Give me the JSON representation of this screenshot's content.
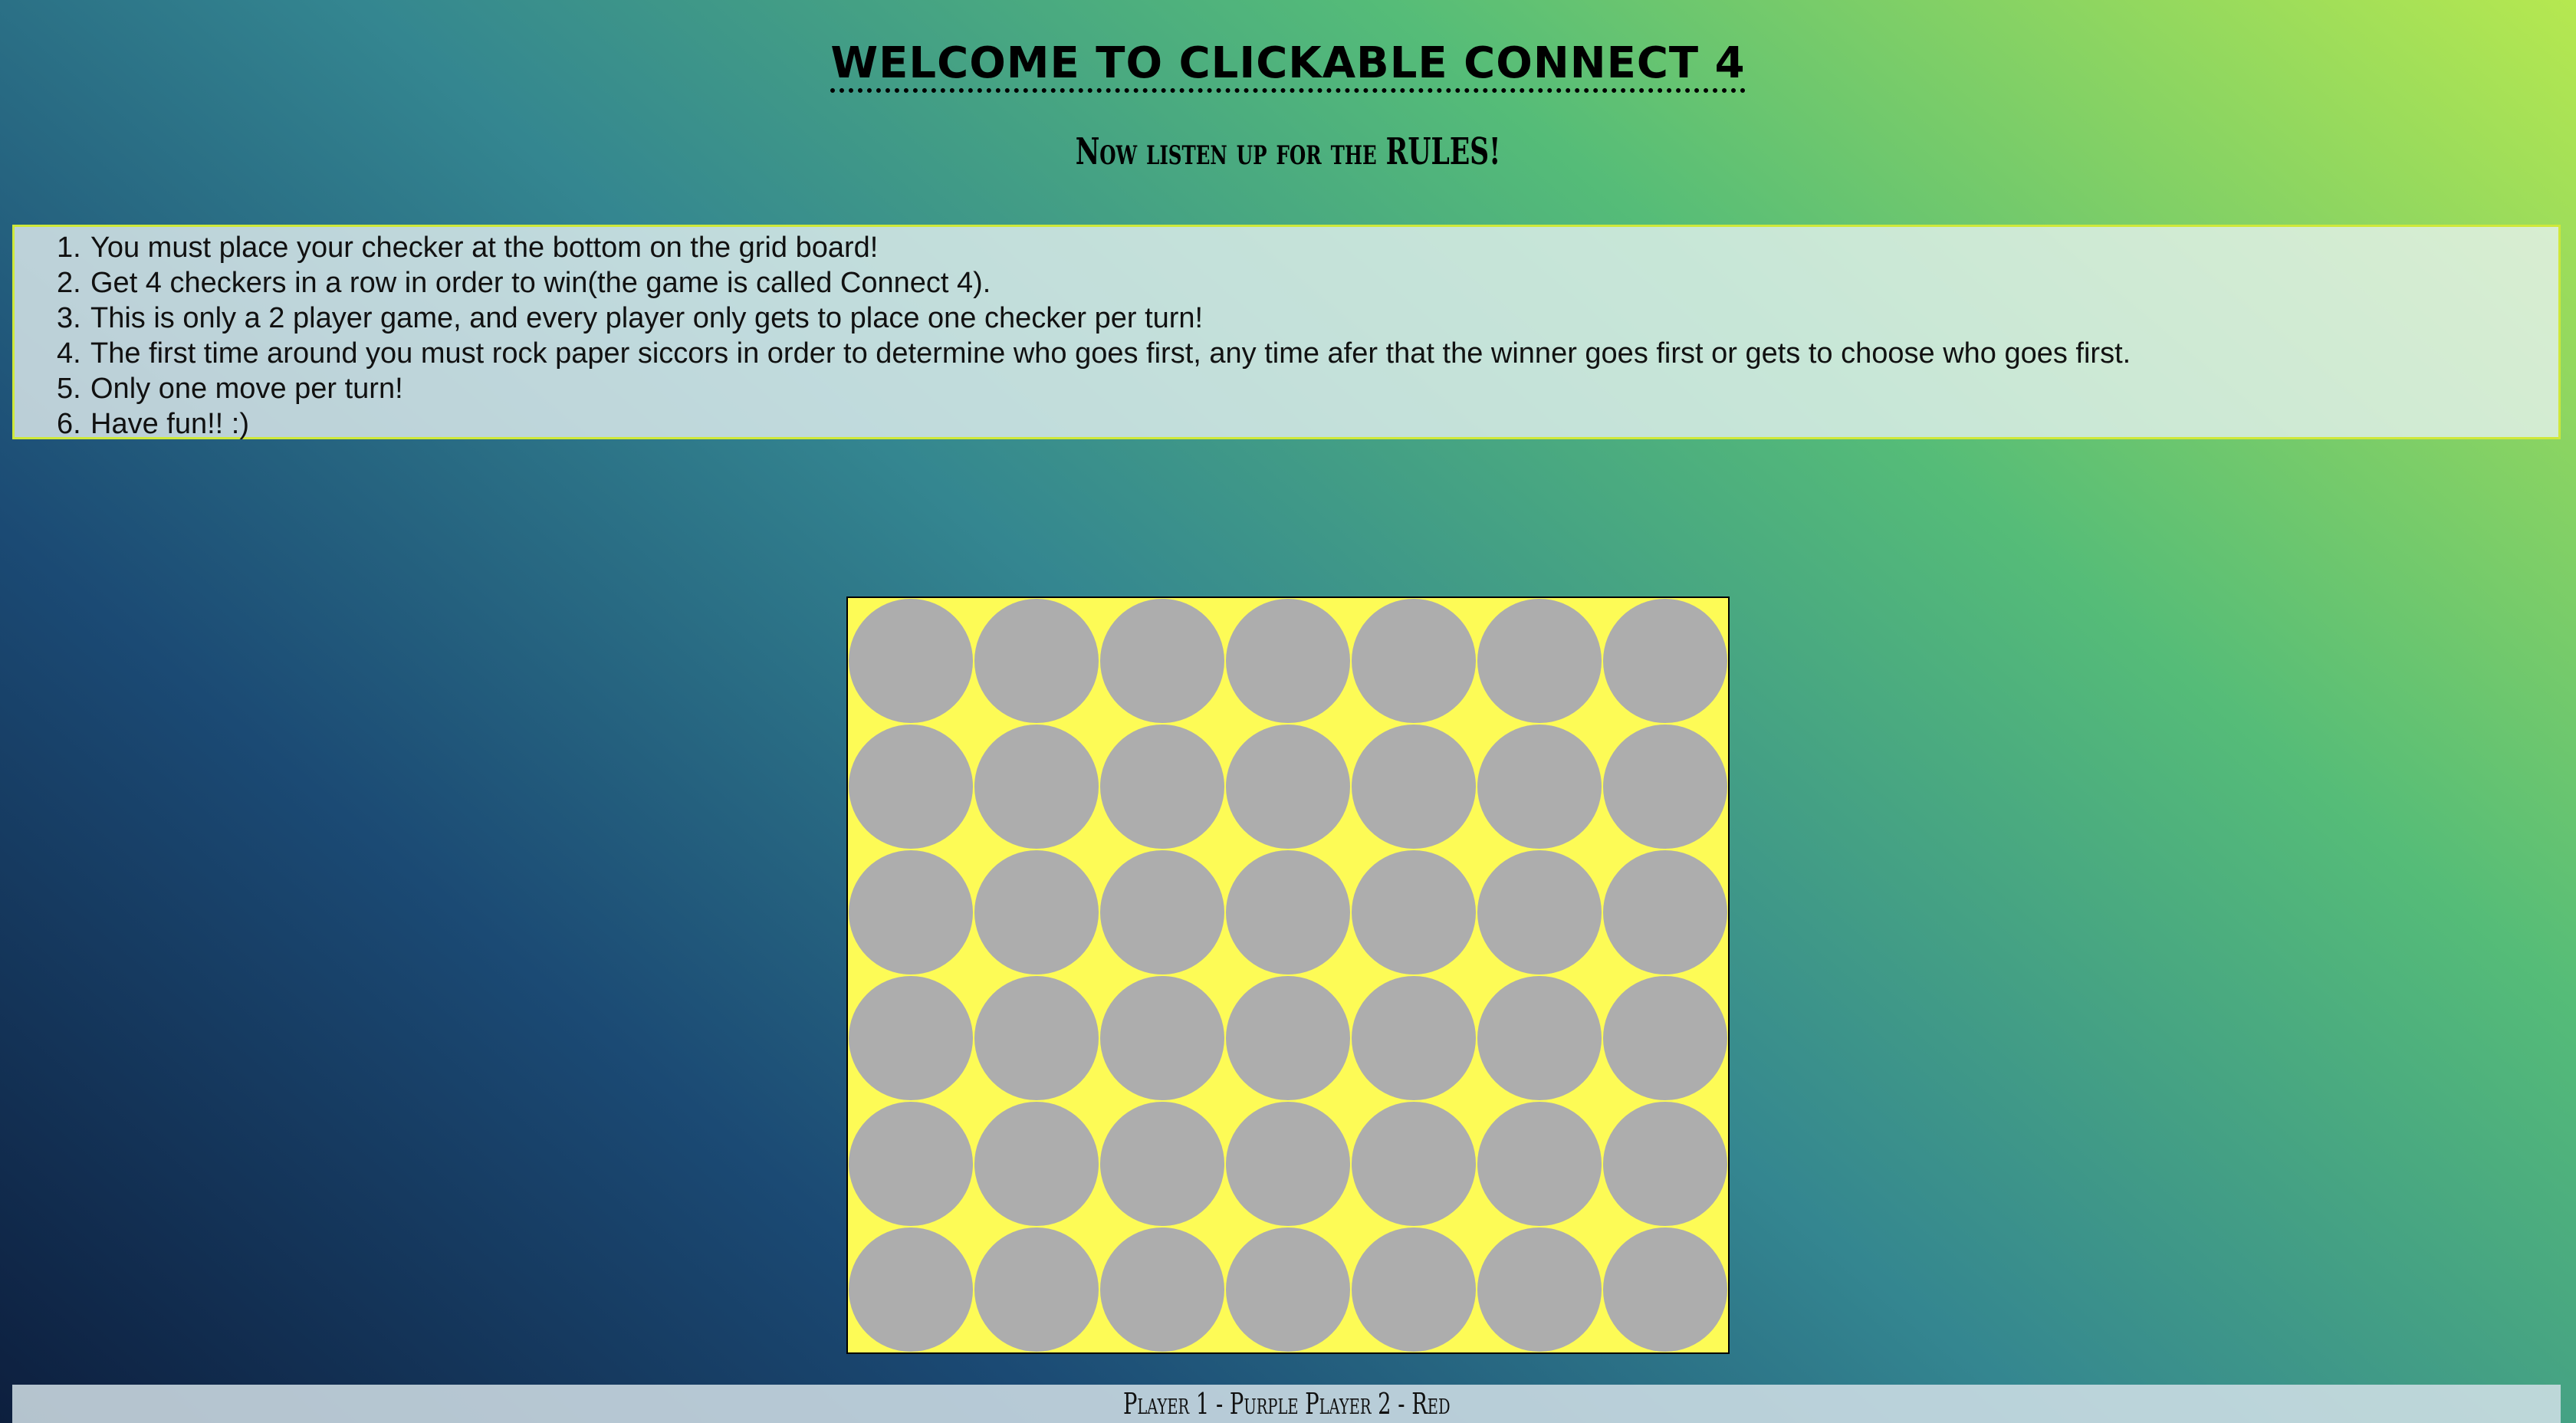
{
  "header": {
    "title": "WELCOME TO CLICKABLE CONNECT 4",
    "subtitle": "Now listen up for the RULES!"
  },
  "rules": [
    {
      "num": "1.",
      "text": "You must place your checker at the bottom on the grid board!"
    },
    {
      "num": "2.",
      "text": "Get 4 checkers in a row in order to win(the game is called Connect 4)."
    },
    {
      "num": "3.",
      "text": "This is only a 2 player game, and every player only gets to place one checker per turn!"
    },
    {
      "num": "4.",
      "text": "The first time around you must rock paper siccors in order to determine who goes first, any time afer that the winner goes first or gets to choose who goes first."
    },
    {
      "num": "5.",
      "text": "Only one move per turn!"
    },
    {
      "num": "6.",
      "text": "Have fun!! :)"
    }
  ],
  "board": {
    "rows": 6,
    "columns": 7,
    "board_color": "#fdfb56",
    "empty_cell_color": "#adadad",
    "cells": [
      [
        "empty",
        "empty",
        "empty",
        "empty",
        "empty",
        "empty",
        "empty"
      ],
      [
        "empty",
        "empty",
        "empty",
        "empty",
        "empty",
        "empty",
        "empty"
      ],
      [
        "empty",
        "empty",
        "empty",
        "empty",
        "empty",
        "empty",
        "empty"
      ],
      [
        "empty",
        "empty",
        "empty",
        "empty",
        "empty",
        "empty",
        "empty"
      ],
      [
        "empty",
        "empty",
        "empty",
        "empty",
        "empty",
        "empty",
        "empty"
      ],
      [
        "empty",
        "empty",
        "empty",
        "empty",
        "empty",
        "empty",
        "empty"
      ]
    ]
  },
  "footer": {
    "players_text": "Player 1 - Purple Player 2 - Red"
  }
}
